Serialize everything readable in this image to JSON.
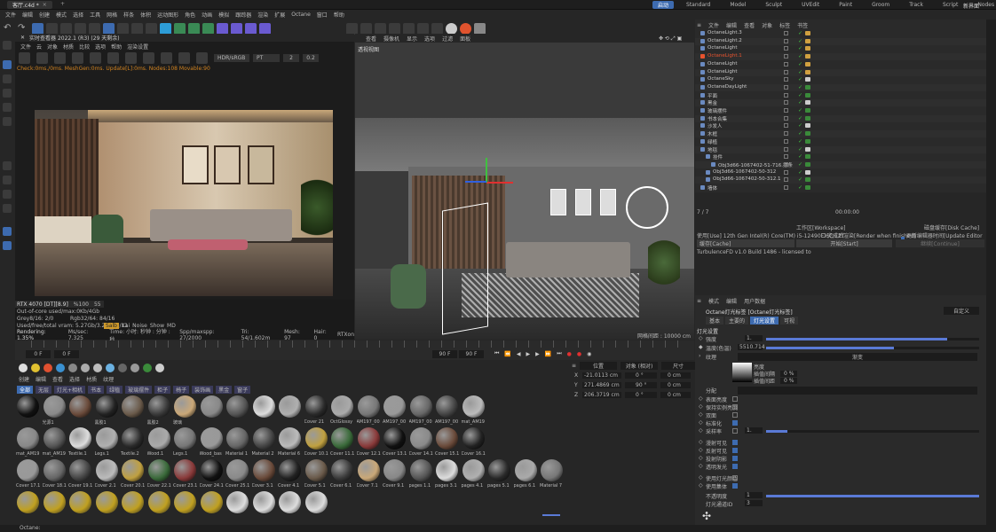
{
  "titlebar": {
    "title": "客厅.c4d *",
    "tab_add": "+"
  },
  "menubar": [
    "文件",
    "编辑",
    "创建",
    "模式",
    "选择",
    "工具",
    "网格",
    "样条",
    "体积",
    "运动图形",
    "角色",
    "动画",
    "模拟",
    "跟踪器",
    "渲染",
    "扩展",
    "Octane",
    "窗口",
    "帮助"
  ],
  "layouts": [
    "启动",
    "Standard",
    "Model",
    "Sculpt",
    "UVEdit",
    "Paint",
    "Groom",
    "Track",
    "Script",
    "Nodes"
  ],
  "active_layout": "启动",
  "new_ui": "新界面",
  "live_viewer": {
    "title": "实时查看器 2022.1 (R3) (29 天剩余)",
    "menu": [
      "文件",
      "云",
      "对象",
      "材质",
      "比较",
      "选项",
      "帮助",
      "渲染设置"
    ],
    "hdr": "HDR/sRGB",
    "pt": "PT",
    "num1": "2",
    "num2": "0.2",
    "status": "Check:0ms./0ms. MeshGen:0ms. Update[L]:0ms. Nodes:108 Movable:90",
    "gpu_label": "RTX 4070 [DT][8.9]",
    "gpu_percent": "%100",
    "gpu_num": "55",
    "core_line": "Out-of-core used/max:0Kb/4Gb",
    "grey_line": "Grey8/16: 2/0",
    "rgb_line": "Rgb32/64: 84/16",
    "vram_line": "Used/free/total vram: 5.27Gb/3.224Gb/11",
    "buttons": [
      "Salb",
      "Kai",
      "Noise",
      "Show",
      "MD"
    ],
    "stats": [
      "Rendering: 1.35%",
      "Ms/sec: 7.325",
      "Time: 小时: 秒钟 : 分钟 : 秒",
      "Spp/maxspp: 27/2000",
      "Tri: 54/1.602m",
      "Mesh: 97",
      "Hair: 0",
      "RTXon"
    ]
  },
  "viewport": {
    "menu": [
      "查看",
      "摄像机",
      "显示",
      "选项",
      "过滤",
      "面板"
    ],
    "label": "透视视图",
    "grid": "网格间距 : 10000 cm"
  },
  "timeline": {
    "left": "0 F",
    "left2": "0 F",
    "end1": "90 F",
    "end2": "90 F"
  },
  "materials": {
    "menu": [
      "创建",
      "编辑",
      "查看",
      "选择",
      "材质",
      "纹理"
    ],
    "filters": [
      "全部",
      "无层",
      "灯光+相机",
      "书本",
      "绿植",
      "玻璃摆件",
      "柜子",
      "椅子",
      "装饰画",
      "黑金",
      "窗子"
    ],
    "labels": [
      [
        "",
        "光源1",
        "",
        "黑胶1",
        "",
        "黑胶2",
        "玻璃",
        "",
        "",
        "",
        "",
        "Cover 21",
        "OctGlossy",
        "AM197_00",
        "AM197_00",
        "AM197_00",
        "AM197_00",
        "mat_AM19"
      ],
      [
        "mat_AM19",
        "mat_AM19",
        "Textile.1",
        "Legs.1",
        "Textile.2",
        "Wood.1",
        "Legs.1",
        "Wood_bas",
        "Material 1",
        "Material 2",
        "Material 6",
        "Cover 10.1",
        "Cover 11.1",
        "Cover 12.1",
        "Cover 13.1",
        "Cover 14.1",
        "Cover 15.1",
        "Cover 16.1"
      ],
      [
        "Cover 17.1",
        "Cover 18.1",
        "Cover 19.1",
        "Cover 2.1",
        "Cover 20.1",
        "Cover 22.1",
        "Cover 23.1",
        "Cover 24.1",
        "Cover 25.1",
        "Cover 3.1",
        "Cover 4.1",
        "Cover 5.1",
        "Cover 6.1",
        "Cover 7.1",
        "Cover 9.1",
        "pages 1.1",
        "pages 3.1",
        "pages 4.1",
        "pages 5.1",
        "pages 6.1",
        "Material 7"
      ],
      [
        "",
        "",
        "",
        "",
        "",
        "",
        "",
        "",
        "",
        "",
        "",
        ""
      ]
    ]
  },
  "coords": {
    "menu": [
      "位置",
      "尺寸",
      "旋转"
    ],
    "rows": [
      {
        "axis": "X",
        "pos": "-21.0113 cm",
        "rot": "0 °",
        "size": "0 cm"
      },
      {
        "axis": "Y",
        "pos": "271.4869 cm",
        "rot": "90 °",
        "size": "0 cm"
      },
      {
        "axis": "Z",
        "pos": "206.3719 cm",
        "rot": "0 °",
        "size": "0 cm"
      }
    ],
    "mode1": "对象 (相对)",
    "mode2": "尺寸"
  },
  "object_manager": {
    "menu": [
      "文件",
      "编辑",
      "查看",
      "对象",
      "标签",
      "书签"
    ],
    "items": [
      {
        "name": "OctaneLight.3",
        "color": "#c8c8c8",
        "indent": 0
      },
      {
        "name": "OctaneLight.2",
        "color": "#c8c8c8",
        "indent": 0
      },
      {
        "name": "OctaneLight",
        "color": "#c8c8c8",
        "indent": 0
      },
      {
        "name": "OctaneLight.1",
        "color": "#e8532e",
        "indent": 0
      },
      {
        "name": "OctaneLight",
        "color": "#c8c8c8",
        "indent": 0
      },
      {
        "name": "OctaneLight",
        "color": "#c8c8c8",
        "indent": 0
      },
      {
        "name": "OctaneSky",
        "color": "#c8c8c8",
        "indent": 0
      },
      {
        "name": "OctaneDayLight",
        "color": "#c8c8c8",
        "indent": 0
      },
      {
        "name": "平面",
        "color": "#c8c8c8",
        "indent": 0
      },
      {
        "name": "黑金",
        "color": "#c8c8c8",
        "indent": 0
      },
      {
        "name": "玻璃摆件",
        "color": "#c8c8c8",
        "indent": 0
      },
      {
        "name": "书本合集",
        "color": "#c8c8c8",
        "indent": 0
      },
      {
        "name": "沙发人",
        "color": "#c8c8c8",
        "indent": 0
      },
      {
        "name": "木框",
        "color": "#c8c8c8",
        "indent": 0
      },
      {
        "name": "绿植",
        "color": "#c8c8c8",
        "indent": 0
      },
      {
        "name": "地毯",
        "color": "#c8c8c8",
        "indent": 0
      },
      {
        "name": "挂件",
        "color": "#c8c8c8",
        "indent": 1
      },
      {
        "name": "Obj3d66-1067402-51-716.摆条",
        "color": "#c8c8c8",
        "indent": 2
      },
      {
        "name": "Obj3d66-1067402-50-312",
        "color": "#c8c8c8",
        "indent": 1
      },
      {
        "name": "Obj3d66-1067402-50-312.1",
        "color": "#c8c8c8",
        "indent": 1
      },
      {
        "name": "墙体",
        "color": "#c8c8c8",
        "indent": 0
      }
    ]
  },
  "render_queue": {
    "frame": "7 / 7",
    "time": "00:00:00",
    "workspace": "工作区[Workspace]",
    "disk_cache": "磁盘缓存[Disk Cache]",
    "cpu_line": "使用[Use] 12th Gen Intel(R) Core(TM) i5-12490F 6C/12T",
    "cb1": "完成后渲染[Render when finished]",
    "cb2": "更新编辑器时间[Update Editor Time-line]",
    "cache": "缓存[Cache]",
    "start": "开始[Start]",
    "continue": "继续[Continue]",
    "build": "TurbulenceFD v1.0 Build 1486 - licensed to"
  },
  "attributes": {
    "menu": [
      "模式",
      "编辑",
      "用户数据"
    ],
    "title": "Octane灯光标签 [Octane灯光标签]",
    "preset": "自定义",
    "tabs": [
      "基本",
      "主要的",
      "灯光设置",
      "可视"
    ],
    "section": "灯光设置",
    "power_label": "强度",
    "power_val": "1.",
    "power_fraction": 0.85,
    "temp_label": "温度(色温)",
    "temp_val": "5510.714",
    "temp_fraction": 0.6,
    "texture_label": "纹理",
    "texture_val": "渐变",
    "grad_rows": [
      {
        "label": "亮度",
        "val": ""
      },
      {
        "label": "插值间隔",
        "val": "0 %"
      },
      {
        "label": "插值间距",
        "val": "0 %"
      }
    ],
    "dist_label": "分配",
    "checks": [
      {
        "label": "表面亮度",
        "on": false
      },
      {
        "label": "保持实例亮度",
        "on": false
      },
      {
        "label": "双面",
        "on": false
      },
      {
        "label": "标准化",
        "on": true
      },
      {
        "label": "采样率",
        "on": false
      }
    ],
    "sample_val": "1.",
    "checks2": [
      {
        "label": "漫射可见",
        "on": true
      },
      {
        "label": "反射可见",
        "on": true
      },
      {
        "label": "投射阴影",
        "on": true
      },
      {
        "label": "透明发光",
        "on": true
      }
    ],
    "checks3": [
      {
        "label": "使用灯光颜色",
        "on": false
      },
      {
        "label": "使用集体",
        "on": true
      }
    ],
    "opacity_label": "不透明度",
    "opacity_val": "1",
    "light_id_label": "灯光通道ID",
    "light_id_val": "3"
  },
  "statusbar": {
    "text": "Octane:"
  }
}
